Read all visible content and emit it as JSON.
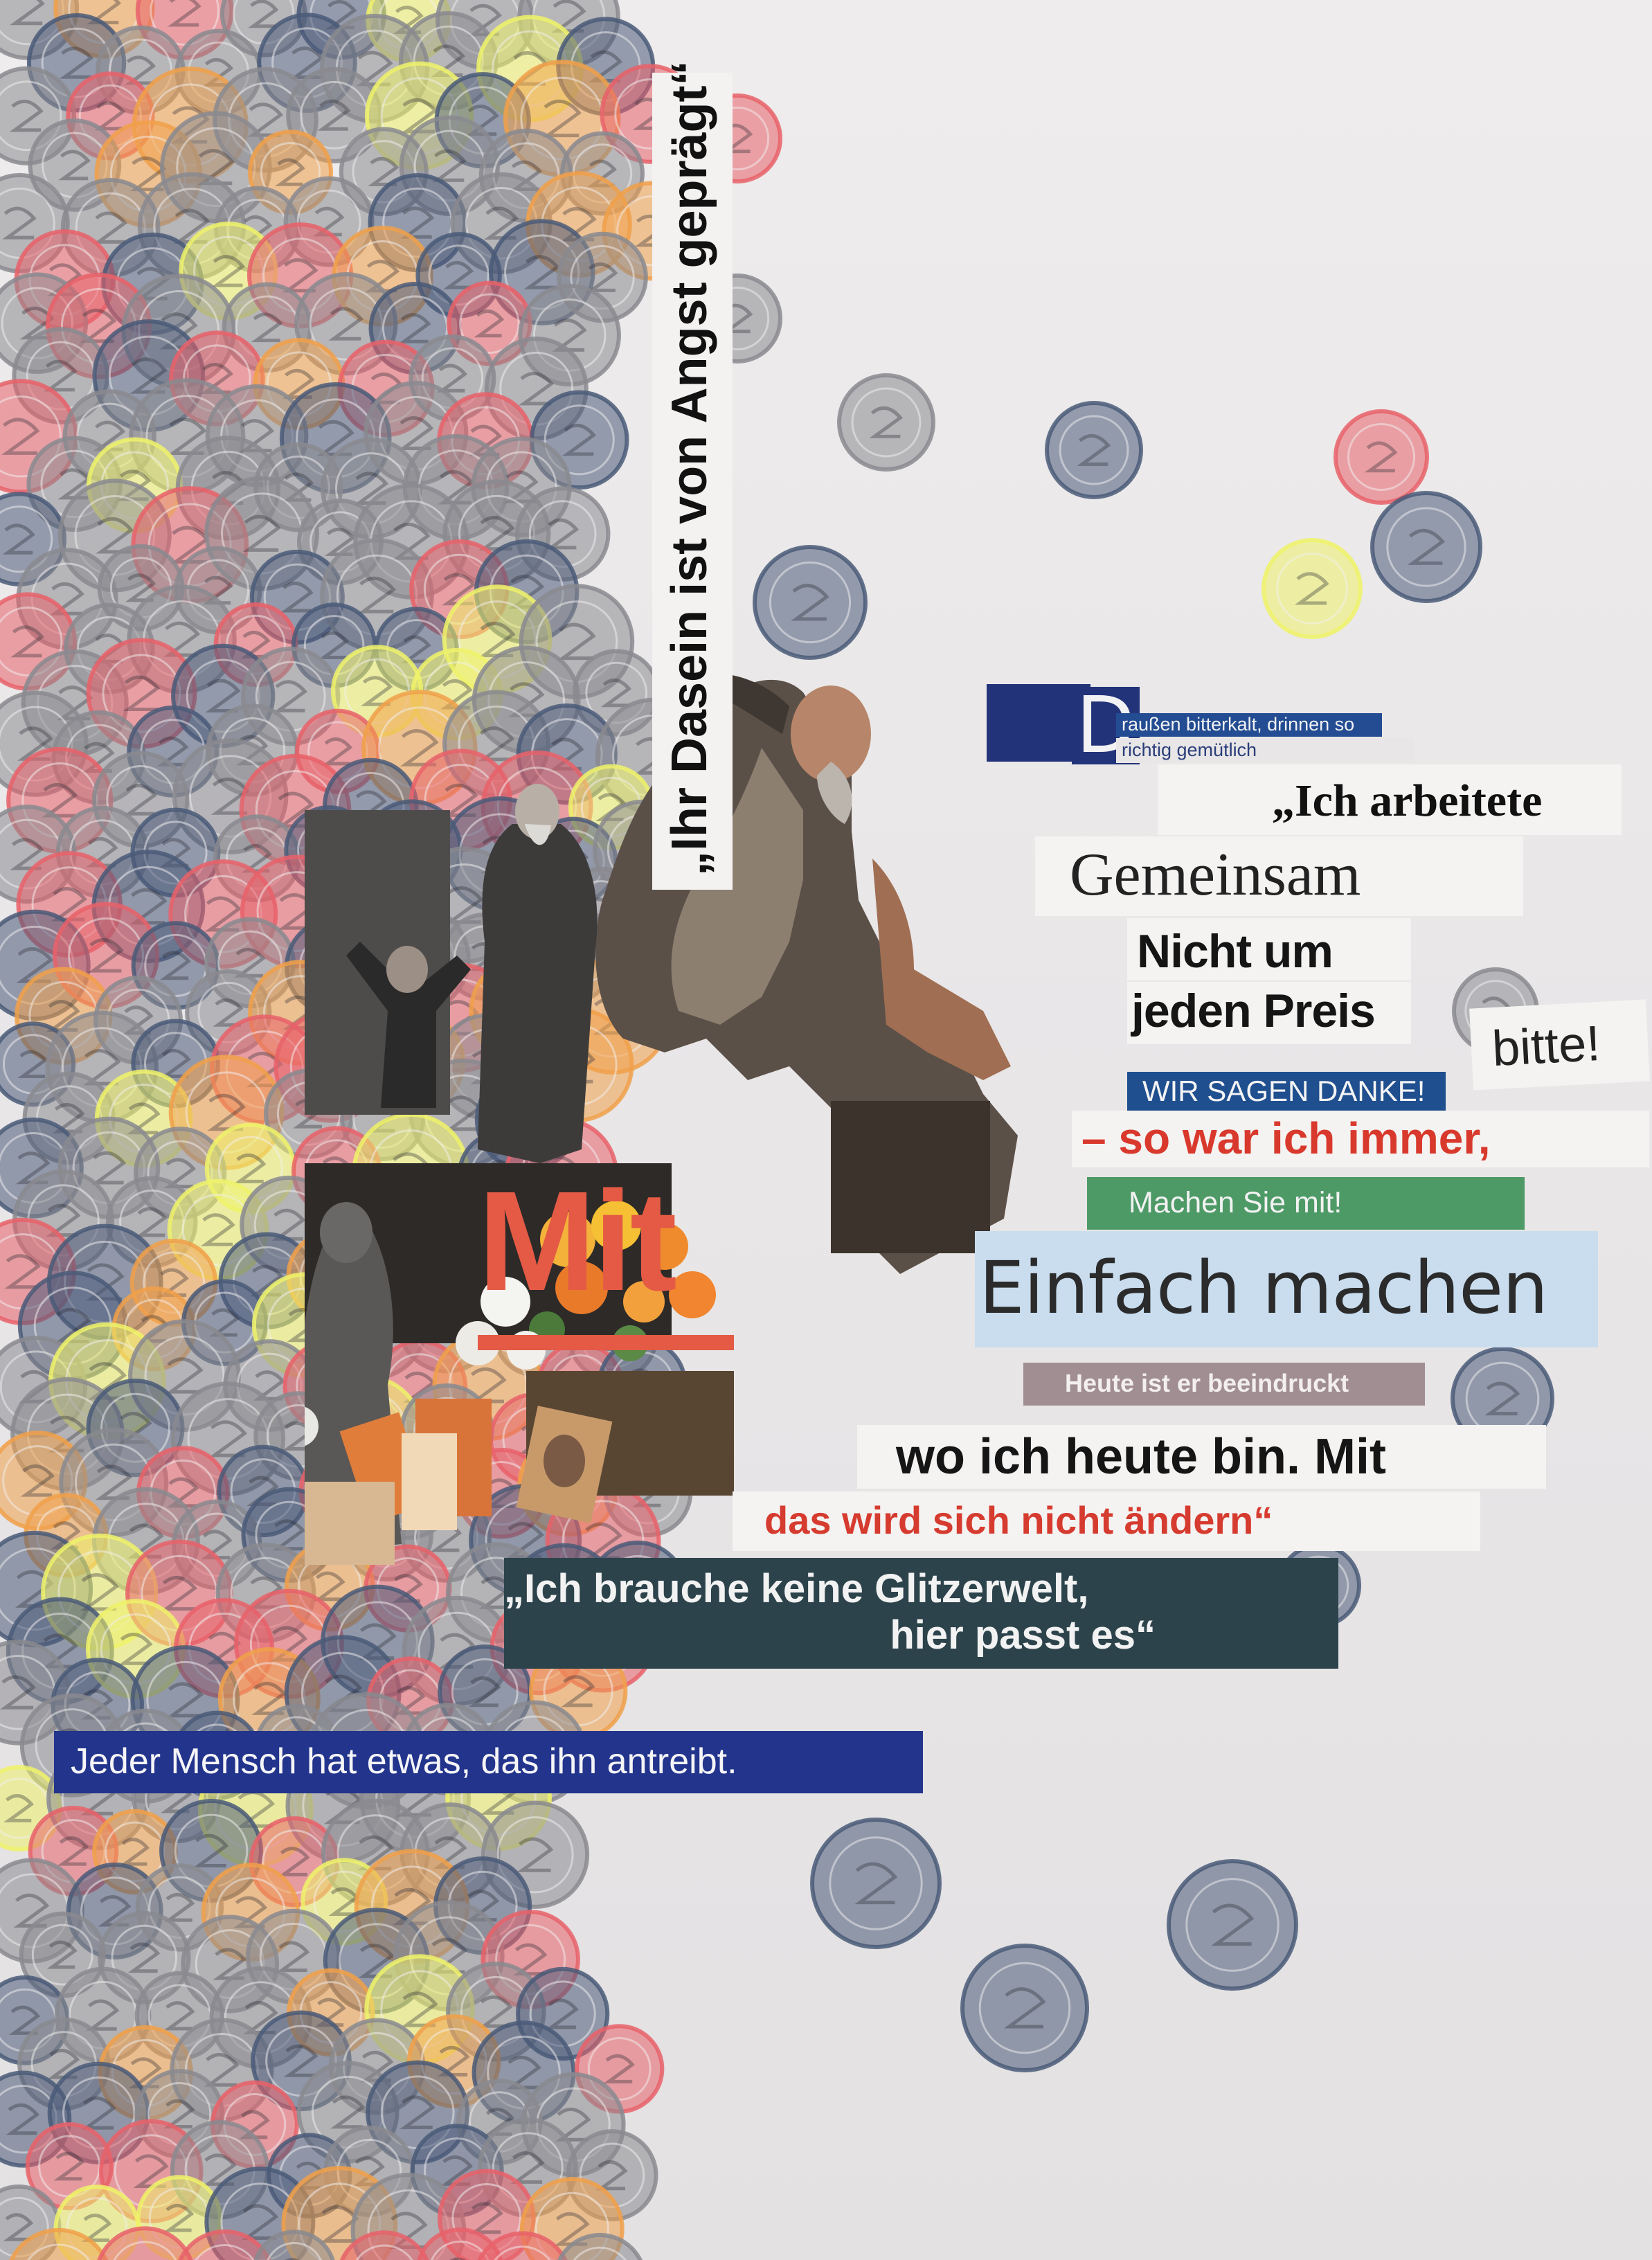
{
  "collage": {
    "vertical_quote": "„Ihr Dasein ist von Angst geprägt“",
    "drop_cap": "D",
    "drop_cap_line_1": "raußen bitterkalt, drinnen so",
    "drop_cap_line_2": "richtig gemütlich",
    "quote_ich_arbeitete": "„Ich arbeitete",
    "gemeinsam": "Gemeinsam",
    "nicht_um": "Nicht um",
    "jeden_preis": "jeden Preis",
    "bitte": "bitte!",
    "wir_sagen_danke": "WIR SAGEN DANKE!",
    "so_war_ich": "– so war ich immer,",
    "machen_sie_mit": "Machen Sie mit!",
    "mit_big": "Mit",
    "einfach_machen": "Einfach machen",
    "heute_ist_er": "Heute ist er beeindruckt",
    "wo_ich_heute": "wo ich heute bin. Mit",
    "das_wird_sich": "das wird sich nicht ändern“",
    "glitzerwelt_line_1": "„Ich brauche keine Glitzerwelt,",
    "glitzerwelt_line_2": "hier passt es“",
    "jeder_mensch": "Jeder Mensch hat etwas, das ihn antreibt."
  },
  "colors": {
    "paper": "#e9e7e8",
    "coin_grey": "#8a8a8f",
    "coin_blue": "#4a5a78",
    "coin_red": "#e8616a",
    "coin_orange": "#f0a04a",
    "coin_yellow": "#eef26a",
    "red_text": "#d63b2f",
    "navy": "#243a8a",
    "dark_teal": "#2a4048",
    "green": "#4f9a68",
    "light_blue": "#c6dced"
  }
}
